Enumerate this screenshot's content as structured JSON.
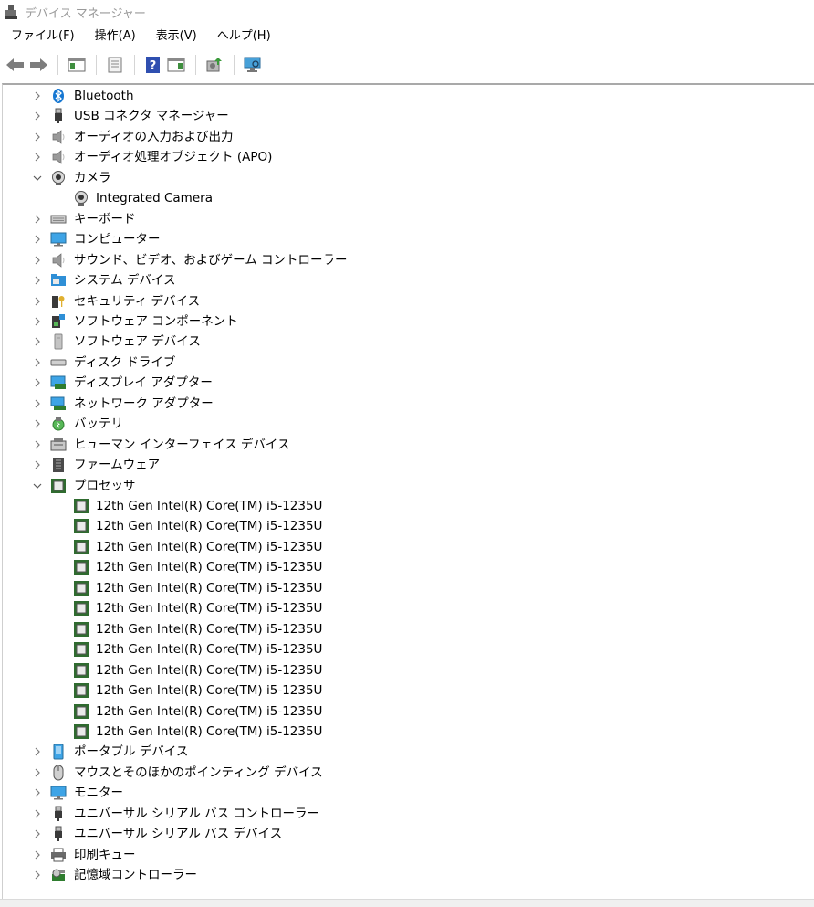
{
  "window": {
    "title": "デバイス マネージャー"
  },
  "menu": [
    "ファイル(F)",
    "操作(A)",
    "表示(V)",
    "ヘルプ(H)"
  ],
  "toolbar_icons": [
    "back-arrow-icon",
    "forward-arrow-icon",
    "show-hide-console-tree-icon",
    "properties-icon",
    "help-icon",
    "action-pane-icon",
    "update-driver-icon",
    "scan-hardware-icon"
  ],
  "tree": [
    {
      "label": "Bluetooth",
      "icon": "bluetooth-icon",
      "expanded": false
    },
    {
      "label": "USB コネクタ マネージャー",
      "icon": "usb-icon",
      "expanded": false
    },
    {
      "label": "オーディオの入力および出力",
      "icon": "speaker-icon",
      "expanded": false
    },
    {
      "label": "オーディオ処理オブジェクト (APO)",
      "icon": "speaker-icon",
      "expanded": false
    },
    {
      "label": "カメラ",
      "icon": "webcam-icon",
      "expanded": true,
      "children": [
        {
          "label": "Integrated Camera",
          "icon": "webcam-icon"
        }
      ]
    },
    {
      "label": "キーボード",
      "icon": "keyboard-icon",
      "expanded": false
    },
    {
      "label": "コンピューター",
      "icon": "monitor-icon",
      "expanded": false
    },
    {
      "label": "サウンド、ビデオ、およびゲーム コントローラー",
      "icon": "speaker-icon",
      "expanded": false
    },
    {
      "label": "システム デバイス",
      "icon": "system-folder-icon",
      "expanded": false
    },
    {
      "label": "セキュリティ デバイス",
      "icon": "security-key-icon",
      "expanded": false
    },
    {
      "label": "ソフトウェア コンポーネント",
      "icon": "software-component-icon",
      "expanded": false
    },
    {
      "label": "ソフトウェア デバイス",
      "icon": "software-device-icon",
      "expanded": false
    },
    {
      "label": "ディスク ドライブ",
      "icon": "disk-drive-icon",
      "expanded": false
    },
    {
      "label": "ディスプレイ アダプター",
      "icon": "display-adapter-icon",
      "expanded": false
    },
    {
      "label": "ネットワーク アダプター",
      "icon": "network-adapter-icon",
      "expanded": false
    },
    {
      "label": "バッテリ",
      "icon": "battery-icon",
      "expanded": false
    },
    {
      "label": "ヒューマン インターフェイス デバイス",
      "icon": "hid-icon",
      "expanded": false
    },
    {
      "label": "ファームウェア",
      "icon": "firmware-icon",
      "expanded": false
    },
    {
      "label": "プロセッサ",
      "icon": "processor-icon",
      "expanded": true,
      "children": [
        {
          "label": "12th Gen Intel(R) Core(TM) i5-1235U",
          "icon": "processor-icon"
        },
        {
          "label": "12th Gen Intel(R) Core(TM) i5-1235U",
          "icon": "processor-icon"
        },
        {
          "label": "12th Gen Intel(R) Core(TM) i5-1235U",
          "icon": "processor-icon"
        },
        {
          "label": "12th Gen Intel(R) Core(TM) i5-1235U",
          "icon": "processor-icon"
        },
        {
          "label": "12th Gen Intel(R) Core(TM) i5-1235U",
          "icon": "processor-icon"
        },
        {
          "label": "12th Gen Intel(R) Core(TM) i5-1235U",
          "icon": "processor-icon"
        },
        {
          "label": "12th Gen Intel(R) Core(TM) i5-1235U",
          "icon": "processor-icon"
        },
        {
          "label": "12th Gen Intel(R) Core(TM) i5-1235U",
          "icon": "processor-icon"
        },
        {
          "label": "12th Gen Intel(R) Core(TM) i5-1235U",
          "icon": "processor-icon"
        },
        {
          "label": "12th Gen Intel(R) Core(TM) i5-1235U",
          "icon": "processor-icon"
        },
        {
          "label": "12th Gen Intel(R) Core(TM) i5-1235U",
          "icon": "processor-icon"
        },
        {
          "label": "12th Gen Intel(R) Core(TM) i5-1235U",
          "icon": "processor-icon"
        }
      ]
    },
    {
      "label": "ポータブル デバイス",
      "icon": "portable-device-icon",
      "expanded": false
    },
    {
      "label": "マウスとそのほかのポインティング デバイス",
      "icon": "mouse-icon",
      "expanded": false
    },
    {
      "label": "モニター",
      "icon": "monitor-icon",
      "expanded": false
    },
    {
      "label": "ユニバーサル シリアル バス コントローラー",
      "icon": "usb-icon",
      "expanded": false
    },
    {
      "label": "ユニバーサル シリアル バス デバイス",
      "icon": "usb-icon",
      "expanded": false
    },
    {
      "label": "印刷キュー",
      "icon": "printer-icon",
      "expanded": false
    },
    {
      "label": "記憶域コントローラー",
      "icon": "storage-controller-icon",
      "expanded": false
    }
  ]
}
